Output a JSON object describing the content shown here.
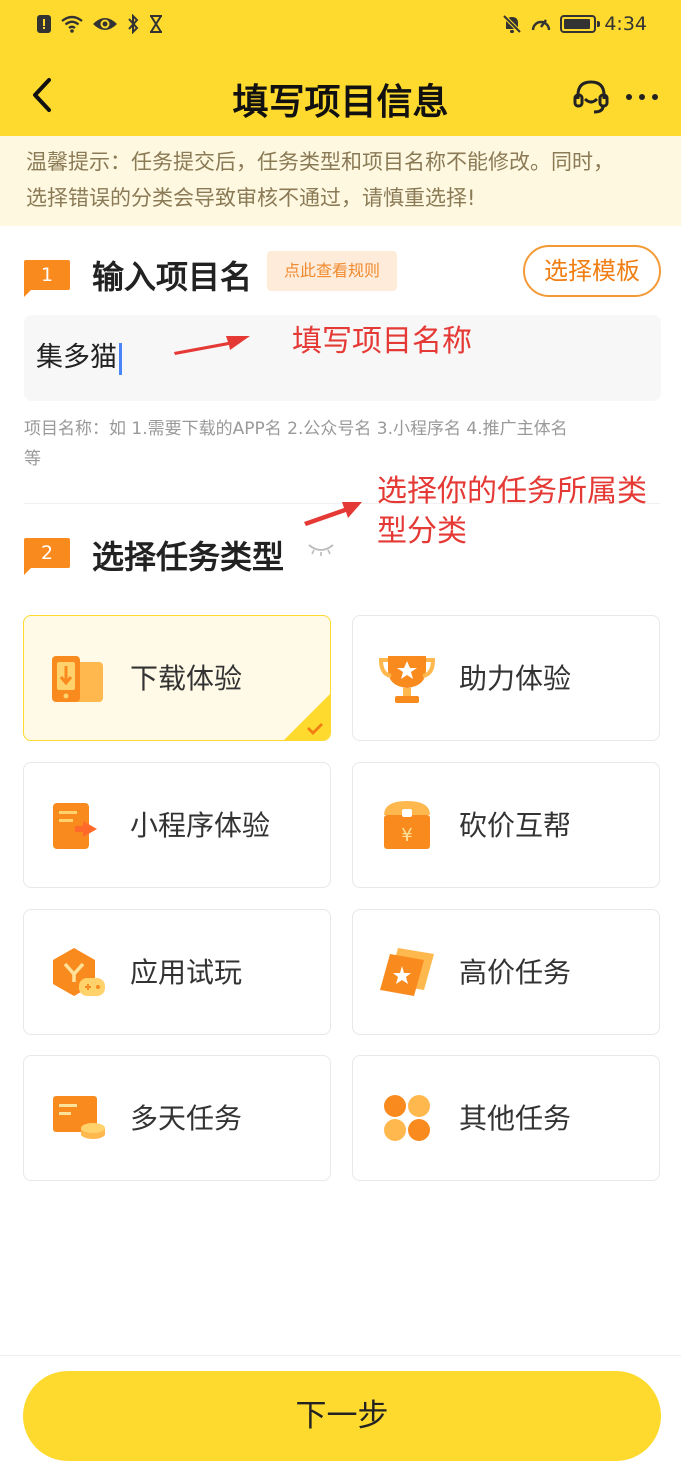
{
  "status_bar": {
    "time": "4:34"
  },
  "nav": {
    "title": "填写项目信息"
  },
  "tip": {
    "text_line1": "温馨提示：任务提交后，任务类型和项目名称不能修改。同时，",
    "text_line2": "选择错误的分类会导致审核不通过，请慎重选择!"
  },
  "section1": {
    "badge": "1",
    "title": "输入项目名",
    "rule_link": "点此查看规则",
    "template_button": "选择模板",
    "input_value": "集多猫",
    "hint_line1": "项目名称：如 1.需要下载的APP名  2.公众号名  3.小程序名   4.推广主体名",
    "hint_line2": "等"
  },
  "annotations": {
    "name_note": "填写项目名称",
    "type_note_line1": "选择你的任务所属类",
    "type_note_line2": "型分类"
  },
  "section2": {
    "badge": "2",
    "title": "选择任务类型",
    "task_types": [
      {
        "label": "下载体验",
        "icon": "download-phone-icon",
        "selected": true
      },
      {
        "label": "助力体验",
        "icon": "trophy-icon",
        "selected": false
      },
      {
        "label": "小程序体验",
        "icon": "mini-program-icon",
        "selected": false
      },
      {
        "label": "砍价互帮",
        "icon": "price-bag-icon",
        "selected": false
      },
      {
        "label": "应用试玩",
        "icon": "game-app-icon",
        "selected": false
      },
      {
        "label": "高价任务",
        "icon": "high-price-tag-icon",
        "selected": false
      },
      {
        "label": "多天任务",
        "icon": "calendar-task-icon",
        "selected": false
      },
      {
        "label": "其他任务",
        "icon": "clover-icon",
        "selected": false
      }
    ]
  },
  "footer": {
    "next_button": "下一步"
  },
  "colors": {
    "brand_yellow": "#FEDA2E",
    "accent_orange": "#F98A1E",
    "annotation_red": "#E53935",
    "tip_background": "#FFF8E1"
  }
}
